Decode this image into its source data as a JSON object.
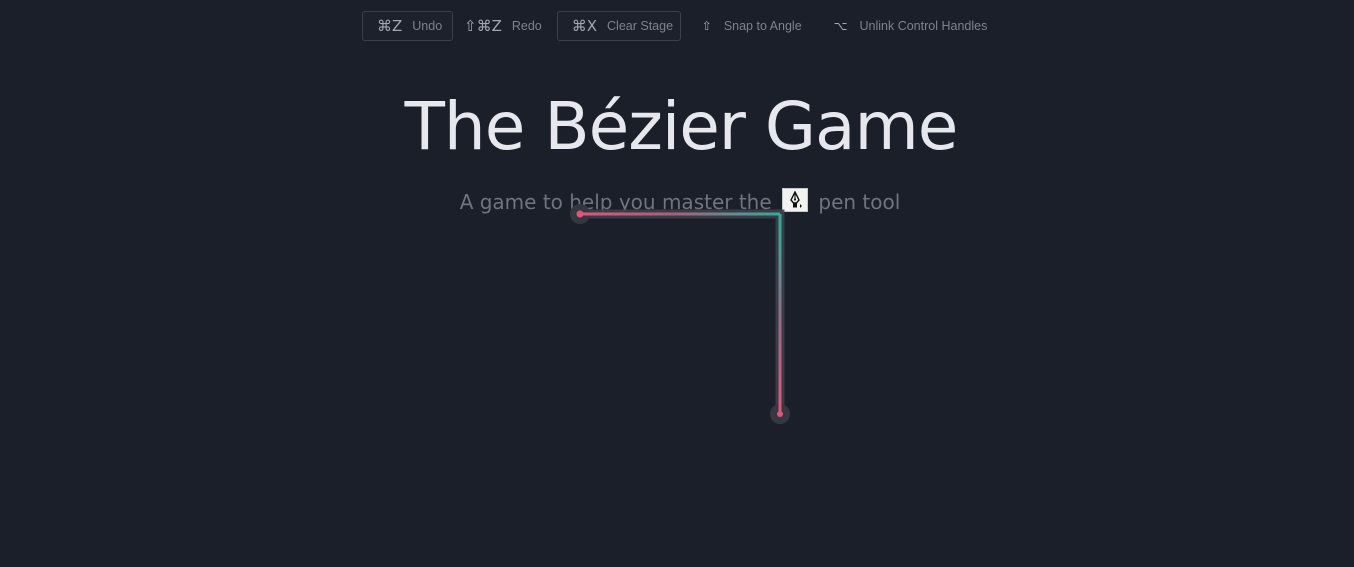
{
  "toolbar": {
    "undo": {
      "key": "⌘Z",
      "label": "Undo"
    },
    "redo": {
      "key": "⇧⌘Z",
      "label": "Redo"
    },
    "clear": {
      "key": "⌘X",
      "label": "Clear Stage"
    },
    "snap": {
      "key": "⇧",
      "label": "Snap to Angle"
    },
    "unlink": {
      "key": "⌥",
      "label": "Unlink Control Handles"
    }
  },
  "header": {
    "title": "The Bézier Game",
    "subtitle_before": "A game to help you master the",
    "subtitle_after": "pen tool",
    "pen_icon": "pen-tool-icon"
  },
  "colors": {
    "background": "#1b1f2a",
    "path_pink": "#e8527a",
    "path_teal": "#27b0a0",
    "guide_gray": "#3b3f48"
  }
}
